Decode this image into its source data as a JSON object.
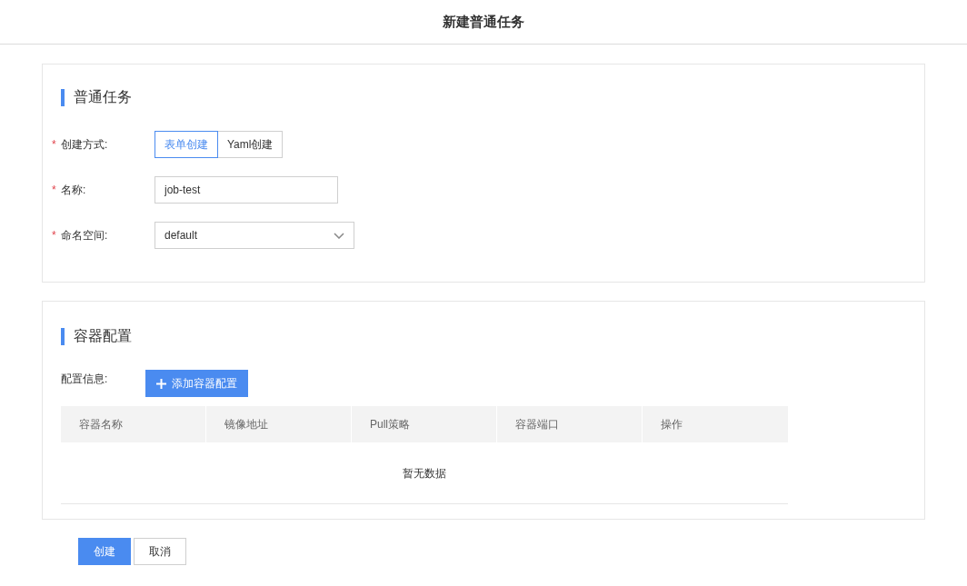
{
  "header": {
    "title": "新建普通任务"
  },
  "basic_section": {
    "title": "普通任务",
    "fields": [
      {
        "kind": "segmented",
        "required_mark": "*",
        "label": "创建方式:",
        "options": [
          {
            "label": "表单创建",
            "selected": true
          },
          {
            "label": "Yaml创建",
            "selected": false
          }
        ]
      },
      {
        "kind": "text",
        "required_mark": "*",
        "label": "名称:",
        "value": "job-test"
      },
      {
        "kind": "select",
        "required_mark": "*",
        "label": "命名空间:",
        "value": "default"
      }
    ]
  },
  "container_section": {
    "title": "容器配置",
    "config_label": "配置信息:",
    "add_button": "添加容器配置",
    "table": {
      "columns": [
        "容器名称",
        "镜像地址",
        "Pull策略",
        "容器端口",
        "操作"
      ],
      "empty_text": "暂无数据"
    }
  },
  "actions": [
    {
      "label": "创建",
      "primary": true
    },
    {
      "label": "取消",
      "primary": false
    }
  ]
}
